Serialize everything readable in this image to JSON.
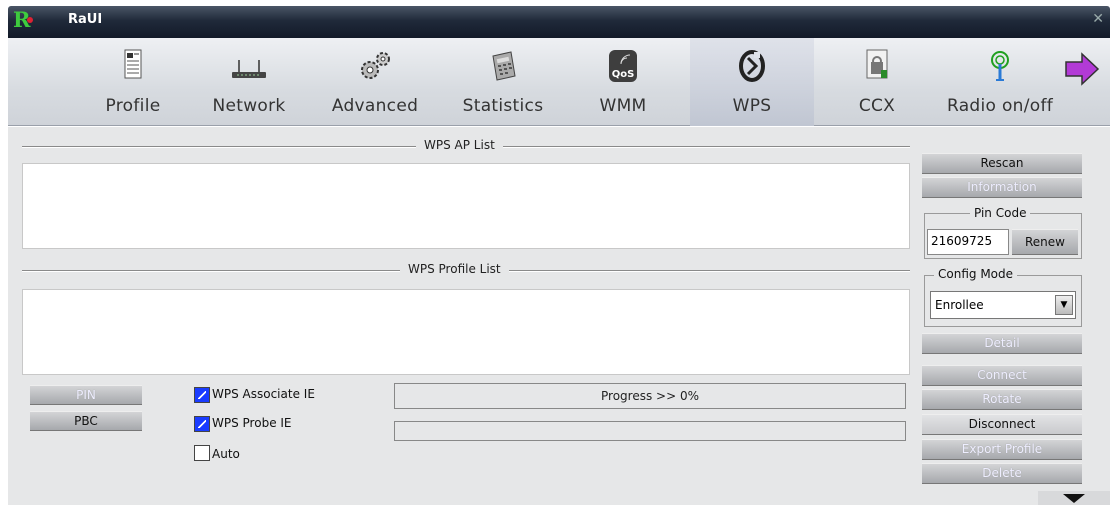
{
  "window": {
    "title": "RaUI"
  },
  "toolbar": {
    "items": [
      {
        "label": "Profile",
        "icon": "profile-icon"
      },
      {
        "label": "Network",
        "icon": "network-icon"
      },
      {
        "label": "Advanced",
        "icon": "gears-icon"
      },
      {
        "label": "Statistics",
        "icon": "statistics-icon"
      },
      {
        "label": "WMM",
        "icon": "qos-icon"
      },
      {
        "label": "WPS",
        "icon": "wps-icon",
        "active": true
      },
      {
        "label": "CCX",
        "icon": "ccx-icon"
      },
      {
        "label": "Radio on/off",
        "icon": "radio-icon"
      }
    ],
    "next_icon": "arrow-right-icon"
  },
  "wps": {
    "ap_list_title": "WPS AP List",
    "profile_list_title": "WPS Profile List",
    "pin_button": "PIN",
    "pbc_button": "PBC",
    "associate_ie": "WPS Associate IE",
    "probe_ie": "WPS Probe IE",
    "auto": "Auto",
    "progress_text": "Progress >> 0%",
    "progress_value": 0
  },
  "side": {
    "rescan": "Rescan",
    "information": "Information",
    "pin_code_title": "Pin Code",
    "pin_code_value": "21609725",
    "renew": "Renew",
    "config_mode_title": "Config Mode",
    "config_mode_value": "Enrollee",
    "detail": "Detail",
    "connect": "Connect",
    "rotate": "Rotate",
    "disconnect": "Disconnect",
    "export_profile": "Export Profile",
    "delete": "Delete"
  }
}
